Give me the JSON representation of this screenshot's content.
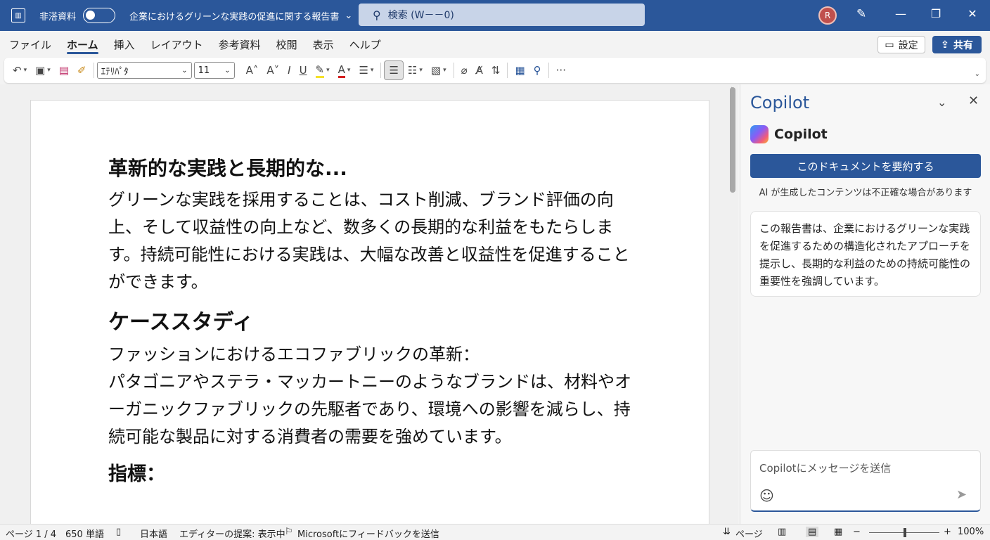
{
  "titlebar": {
    "app_icon": "word-doc-icon",
    "autosave_label": "非溚資料",
    "doc_title": "企業におけるグリーンな実践の促進に関する報告書",
    "search_placeholder": "検索 (W－－0)",
    "avatar_initial": "R"
  },
  "tabs": [
    "ファイル",
    "ホーム",
    "挿入",
    "レイアウト",
    "参考資料",
    "校閲",
    "表示",
    "ヘルプ"
  ],
  "ribbon_actions": {
    "settings_label": "設定",
    "share_label": "共有"
  },
  "toolbar": {
    "font_name": "ｴﾃﾘﾊﾟﾀ",
    "font_size": "11"
  },
  "document": {
    "heading1": "革新的な実践と長期的な...",
    "para1": "グリーンな実践を採用することは、コスト削減、ブランド評価の向上、そして収益性の向上など、数多くの長期的な利益をもたらします。持続可能性における実践は、大幅な改善と収益性を促進することができます。",
    "heading2": "ケーススタディ",
    "para2_line1": "ファッションにおけるエコファブリックの革新：",
    "para2_line2": "パタゴニアやステラ・マッカートニーのようなブランドは、材料やオーガニックファブリックの先駆者であり、環境への影響を減らし、持続可能な製品に対する消費者の需要を強めています。",
    "heading3": "指標："
  },
  "copilot": {
    "panel_title": "Copilot",
    "brand_name": "Copilot",
    "summarize_button": "このドキュメントを要約する",
    "disclaimer": "AI が生成したコンテンツは不正確な場合があります",
    "response": "この報告書は、企業におけるグリーンな実践を促進するための構造化されたアプローチを提示し、長期的な利益のための持続可能性の重要性を強調しています。",
    "input_placeholder": "Copilotにメッセージを送信"
  },
  "statusbar": {
    "page": "ページ 1 / 4",
    "words": "650 単語",
    "language": "日本語",
    "editor": "エディターの提案: 表示中",
    "feedback": "Microsoftにフィードバックを送信",
    "focus": "ページ",
    "zoom": "100%"
  },
  "colors": {
    "accent": "#2b579a",
    "titlebar": "#2b579a",
    "avatar": "#c0504d"
  }
}
